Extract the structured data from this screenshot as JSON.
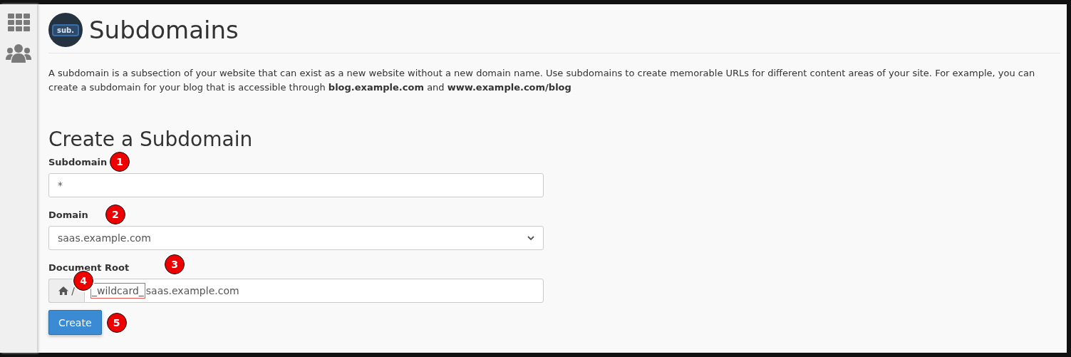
{
  "sidebar": {
    "items": [
      {
        "kind": "grid"
      },
      {
        "kind": "users"
      }
    ]
  },
  "header": {
    "logo_text": "sub.",
    "title": "Subdomains"
  },
  "description": "A subdomain is a subsection of your website that can exist as a new website without a new domain name. Use subdomains to create memorable URLs for different content areas of your site. For example, you can create a subdomain for your blog that is accessible through **blog.example.com** and **www.example.com/blog**",
  "form": {
    "title": "Create a Subdomain",
    "subdomain": {
      "label": "Subdomain",
      "value": "*",
      "marker": "1"
    },
    "domain": {
      "label": "Domain",
      "value": "saas.example.com",
      "marker": "2"
    },
    "document_root": {
      "label": "Document Root",
      "prefix": "/",
      "highlighted": "_wildcard_",
      "value": "saas.example.com",
      "marker": "3",
      "prefix_marker": "4"
    },
    "submit": {
      "label": "Create",
      "marker": "5"
    }
  }
}
